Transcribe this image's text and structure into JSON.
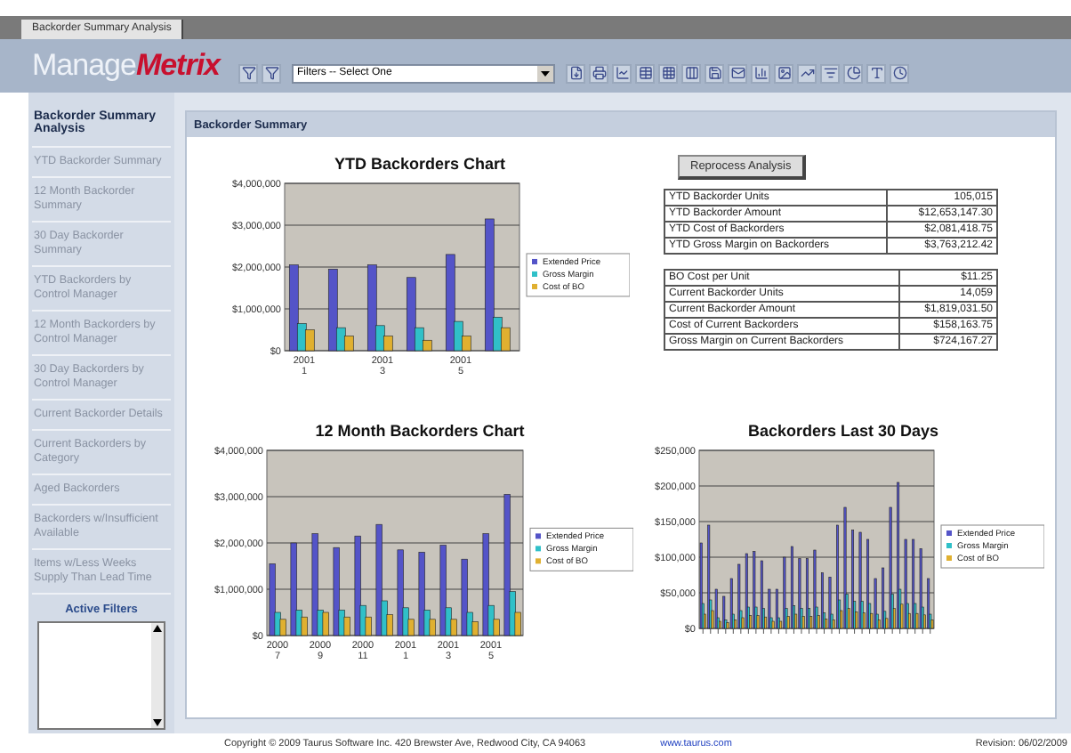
{
  "window_tab": {
    "label": "Backorder Summary Analysis",
    "selected": true
  },
  "logo": {
    "part_1": "Manage",
    "part_2": "Metrix"
  },
  "toolbar": {
    "filter_select": {
      "value": "Filters -- Select One"
    }
  },
  "sidebar": {
    "title": "Backorder Summary Analysis",
    "items": [
      {
        "label": "YTD Backorder Summary",
        "selected": false
      },
      {
        "label": "12 Month Backorder Summary",
        "selected": false
      },
      {
        "label": "30 Day Backorder Summary",
        "selected": false
      },
      {
        "label": "YTD Backorders by Control Manager",
        "selected": false
      },
      {
        "label": "12 Month Backorders by Control Manager",
        "selected": false
      },
      {
        "label": "30 Day Backorders by Control Manager",
        "selected": false
      },
      {
        "label": "Current Backorder Details",
        "selected": false
      },
      {
        "label": "Current Backorders by Category",
        "selected": false
      },
      {
        "label": "Aged Backorders",
        "selected": false
      },
      {
        "label": "Backorders w/Insufficient Available",
        "selected": false
      },
      {
        "label": "Items w/Less Weeks Supply Than Lead Time",
        "selected": false
      }
    ],
    "filters_title": "Active Filters"
  },
  "section_title": "Backorder Summary",
  "reprocess_button": "Reprocess Analysis",
  "ytd_table": [
    {
      "label": "YTD Backorder Units",
      "value": "105,015"
    },
    {
      "label": "YTD Backorder Amount",
      "value": "$12,653,147.30"
    },
    {
      "label": "YTD Cost of Backorders",
      "value": "$2,081,418.75"
    },
    {
      "label": "YTD Gross Margin on Backorders",
      "value": "$3,763,212.42"
    }
  ],
  "current_table": [
    {
      "label": "BO Cost per Unit",
      "value": "$11.25"
    },
    {
      "label": "Current Backorder Units",
      "value": "14,059"
    },
    {
      "label": "Current Backorder Amount",
      "value": "$1,819,031.50"
    },
    {
      "label": "Cost of Current Backorders",
      "value": "$158,163.75"
    },
    {
      "label": "Gross Margin on Current Backorders",
      "value": "$724,167.27"
    }
  ],
  "charts": [
    {
      "chart_data": {
        "type": "bar",
        "title": "YTD Backorders Chart",
        "categories": [
          "2001\n1",
          null,
          "2001\n3",
          null,
          "2001\n5",
          null
        ],
        "stacked": false,
        "grid": true,
        "legend": true,
        "ylim": [
          0,
          4000000
        ],
        "yticks": [
          {
            "value": 0,
            "label": "$0"
          },
          {
            "value": 1000000,
            "label": "$1,000,000"
          },
          {
            "value": 2000000,
            "label": "$2,000,000"
          },
          {
            "value": 3000000,
            "label": "$3,000,000"
          },
          {
            "value": 4000000,
            "label": "$4,000,000"
          }
        ],
        "series": [
          {
            "name": "Extended Price",
            "color": "#5454c8",
            "values": [
              2050000,
              1950000,
              2050000,
              1750000,
              2300000,
              3150000
            ]
          },
          {
            "name": "Gross Margin",
            "color": "#30c0c8",
            "values": [
              650000,
              550000,
              600000,
              550000,
              700000,
              800000
            ]
          },
          {
            "name": "Cost of BO",
            "color": "#e0b030",
            "values": [
              500000,
              350000,
              350000,
              250000,
              350000,
              550000
            ]
          }
        ]
      }
    },
    {
      "chart_data": {
        "type": "bar",
        "title": "12 Month Backorders Chart",
        "categories": [
          "2000\n7",
          null,
          "2000\n9",
          null,
          "2000\n11",
          null,
          "2001\n1",
          null,
          "2001\n3",
          null,
          "2001\n5",
          null
        ],
        "stacked": false,
        "grid": true,
        "legend": true,
        "ylim": [
          0,
          4000000
        ],
        "yticks": [
          {
            "value": 0,
            "label": "$0"
          },
          {
            "value": 1000000,
            "label": "$1,000,000"
          },
          {
            "value": 2000000,
            "label": "$2,000,000"
          },
          {
            "value": 3000000,
            "label": "$3,000,000"
          },
          {
            "value": 4000000,
            "label": "$4,000,000"
          }
        ],
        "series": [
          {
            "name": "Extended Price",
            "color": "#5454c8",
            "values": [
              1550000,
              2000000,
              2200000,
              1900000,
              2150000,
              2400000,
              1850000,
              1800000,
              1950000,
              1650000,
              2200000,
              3050000
            ]
          },
          {
            "name": "Gross Margin",
            "color": "#30c0c8",
            "values": [
              500000,
              550000,
              550000,
              550000,
              650000,
              750000,
              600000,
              550000,
              600000,
              500000,
              650000,
              950000
            ]
          },
          {
            "name": "Cost of BO",
            "color": "#e0b030",
            "values": [
              350000,
              400000,
              500000,
              400000,
              400000,
              450000,
              350000,
              350000,
              350000,
              300000,
              350000,
              500000
            ]
          }
        ]
      }
    },
    {
      "chart_data": {
        "type": "bar",
        "title": "Backorders Last 30 Days",
        "stacked": false,
        "grid": true,
        "legend": true,
        "ylim": [
          0,
          250000
        ],
        "yticks": [
          {
            "value": 0,
            "label": "$0"
          },
          {
            "value": 50000,
            "label": "$50,000"
          },
          {
            "value": 100000,
            "label": "$100,000"
          },
          {
            "value": 150000,
            "label": "$150,000"
          },
          {
            "value": 200000,
            "label": "$200,000"
          },
          {
            "value": 250000,
            "label": "$250,000"
          }
        ],
        "series": [
          {
            "name": "Extended Price",
            "color": "#5454c8",
            "values": [
              120000,
              145000,
              55000,
              45000,
              70000,
              90000,
              105000,
              108000,
              95000,
              55000,
              55000,
              100000,
              115000,
              98000,
              98000,
              110000,
              78000,
              72000,
              145000,
              170000,
              138000,
              135000,
              125000,
              70000,
              85000,
              170000,
              205000,
              125000,
              125000,
              112000,
              70000
            ]
          },
          {
            "name": "Gross Margin",
            "color": "#30c0c8",
            "values": [
              35000,
              40000,
              15000,
              12000,
              20000,
              25000,
              30000,
              30000,
              28000,
              15000,
              15000,
              28000,
              32000,
              28000,
              28000,
              30000,
              22000,
              20000,
              40000,
              48000,
              38000,
              38000,
              35000,
              20000,
              24000,
              48000,
              55000,
              35000,
              35000,
              30000,
              20000
            ]
          },
          {
            "name": "Cost of BO",
            "color": "#e0b030",
            "values": [
              20000,
              25000,
              10000,
              8000,
              12000,
              15000,
              18000,
              18000,
              16000,
              10000,
              10000,
              17000,
              20000,
              17000,
              17000,
              18000,
              13000,
              12000,
              25000,
              28000,
              23000,
              22000,
              21000,
              12000,
              14000,
              28000,
              34000,
              21000,
              21000,
              19000,
              12000
            ]
          }
        ]
      }
    }
  ],
  "footer": {
    "copyright": "Copyright © 2009 Taurus Software Inc.   420 Brewster Ave, Redwood City, CA 94063",
    "link": "www.taurus.com",
    "revision": "Revision: 06/02/2009"
  }
}
